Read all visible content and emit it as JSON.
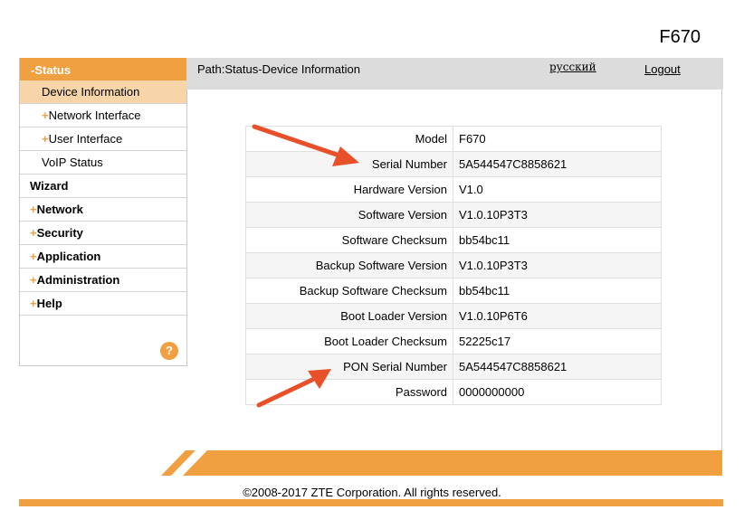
{
  "device_model": "F670",
  "sidebar": {
    "header": "-Status",
    "status_items": [
      {
        "label": "Device Information",
        "plus": ""
      },
      {
        "label": "Network Interface",
        "plus": "+"
      },
      {
        "label": "User Interface",
        "plus": "+"
      },
      {
        "label": "VoIP Status",
        "plus": ""
      }
    ],
    "top_items": [
      {
        "label": "Wizard",
        "plus": ""
      },
      {
        "label": "Network",
        "plus": "+"
      },
      {
        "label": "Security",
        "plus": "+"
      },
      {
        "label": "Application",
        "plus": "+"
      },
      {
        "label": "Administration",
        "plus": "+"
      },
      {
        "label": "Help",
        "plus": "+"
      }
    ],
    "help_icon": "?"
  },
  "topbar": {
    "path": "Path:Status-Device Information",
    "language_link": "русский",
    "logout_label": "Logout"
  },
  "device_info": [
    {
      "label": "Model",
      "value": "F670"
    },
    {
      "label": "Serial Number",
      "value": "5A544547C8858621"
    },
    {
      "label": "Hardware Version",
      "value": "V1.0"
    },
    {
      "label": "Software Version",
      "value": "V1.0.10P3T3"
    },
    {
      "label": "Software Checksum",
      "value": "bb54bc11"
    },
    {
      "label": "Backup Software Version",
      "value": "V1.0.10P3T3"
    },
    {
      "label": "Backup Software Checksum",
      "value": "bb54bc11"
    },
    {
      "label": "Boot Loader Version",
      "value": "V1.0.10P6T6"
    },
    {
      "label": "Boot Loader Checksum",
      "value": "52225c17"
    },
    {
      "label": "PON Serial Number",
      "value": "5A544547C8858621"
    },
    {
      "label": "Password",
      "value": "0000000000"
    }
  ],
  "footer": {
    "copyright": "©2008-2017 ZTE Corporation. All rights reserved."
  },
  "colors": {
    "accent": "#f0a040",
    "active_item": "#f7d5a8",
    "annotation_arrow": "#e8502a"
  }
}
